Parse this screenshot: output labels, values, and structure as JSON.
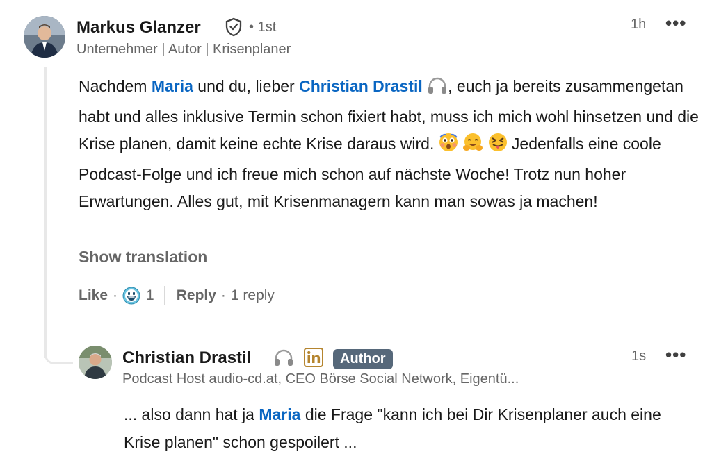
{
  "comment": {
    "author_name": "Markus Glanzer",
    "connection": "1st",
    "headline": "Unternehmer | Autor | Krisenplaner",
    "time": "1h",
    "body": {
      "p1": "Nachdem ",
      "mention1": "Maria",
      "p2": " und du, lieber ",
      "mention2": "Christian Drastil",
      "p3": ", euch ja bereits zusammengetan habt und alles inklusive Termin schon fixiert habt, muss ich mich wohl hinsetzen und die Krise planen, damit keine echte Krise daraus wird. ",
      "p4": " Jedenfalls eine coole Podcast-Folge und ich freue mich schon auf nächste Woche! Trotz nun hoher Erwartungen. Alles gut, mit Krisenmanagern kann man sowas ja machen!"
    },
    "show_translation": "Show translation",
    "like_label": "Like",
    "reaction_count": "1",
    "reply_label": "Reply",
    "reply_count": "1 reply",
    "icons": {
      "verified": "verified-shield-icon",
      "headphones": "headphones-icon",
      "more": "more-options-icon",
      "reaction": "grinning-reaction-icon",
      "emoji1": "flushed-face-emoji",
      "emoji2": "hugging-face-emoji",
      "emoji3": "squinting-tongue-emoji"
    }
  },
  "reply": {
    "author_name": "Christian Drastil",
    "author_badge": "Author",
    "headline": "Podcast Host audio-cd.at, CEO Börse Social Network, Eigentü...",
    "time": "1s",
    "body": {
      "p1": "... also dann hat ja ",
      "mention1": "Maria",
      "p2": " die Frage \"kann ich bei Dir Krisenplaner auch eine Krise planen\" schon gespoilert ..."
    },
    "icons": {
      "headphones": "headphones-icon",
      "linkedin": "linkedin-icon",
      "more": "more-options-icon"
    }
  },
  "colors": {
    "link": "#0a66c2",
    "muted": "#666666",
    "badge": "#56687a",
    "linkedin_gold": "#b5852f"
  }
}
